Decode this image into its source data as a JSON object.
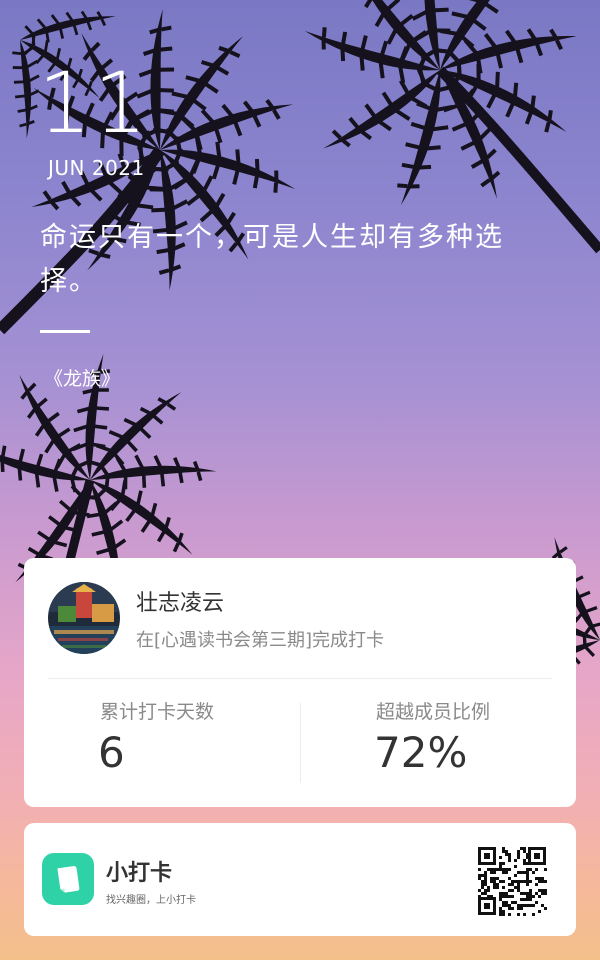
{
  "date": {
    "day": "11",
    "month_year": "JUN 2021"
  },
  "quote": {
    "text": "命运只有一个，可是人生却有多种选择。",
    "source": "《龙族》"
  },
  "checkin_card": {
    "username": "壮志凌云",
    "checkin_text": "在[心遇读书会第三期]完成打卡",
    "stats": [
      {
        "label": "累计打卡天数",
        "value": "6"
      },
      {
        "label": "超越成员比例",
        "value": "72%"
      }
    ]
  },
  "app_card": {
    "name": "小打卡",
    "slogan": "找兴趣圈，上小打卡"
  },
  "colors": {
    "brand": "#2fd2a7",
    "card_bg": "#ffffff",
    "text_primary": "#333333",
    "text_secondary": "#8a8a8a"
  },
  "icons": {
    "app_logo": "note-card-icon",
    "qr": "qr-code-icon"
  }
}
